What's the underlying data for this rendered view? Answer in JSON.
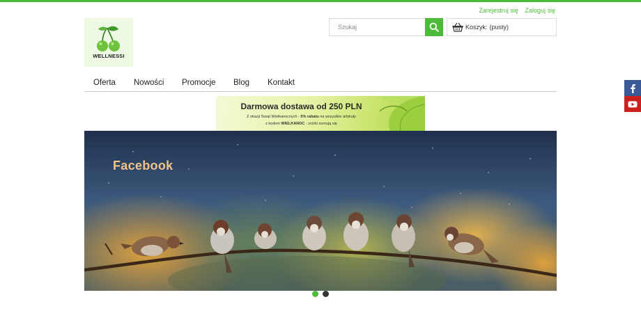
{
  "header": {
    "register_link": "Zarejestruj się",
    "login_link": "Zaloguj się",
    "logo_text": "WELLNESSI"
  },
  "search": {
    "placeholder": "Szukaj",
    "icon": "search-icon"
  },
  "cart": {
    "label": "Koszyk:",
    "status": "(pusty)",
    "icon": "basket-icon"
  },
  "nav": {
    "items": [
      "Oferta",
      "Nowości",
      "Promocje",
      "Blog",
      "Kontakt"
    ]
  },
  "promo_banner": {
    "title": "Darmowa dostawa od 250 PLN",
    "line1_a": "Z okazji Świąt Wielkanocnych - ",
    "line1_b": "5% rabatu",
    "line1_c": " na wszystkie artykuły",
    "line2_a": "z kodem ",
    "line2_b": "WIELKANOC",
    "line2_c": " - zniżki sumują się"
  },
  "slider": {
    "slide_title": "Facebook",
    "active_dot": 1
  },
  "social": {
    "icons": [
      "facebook-icon",
      "youtube-icon"
    ]
  },
  "colors": {
    "accent": "#4cbb3a",
    "facebook": "#3b5998",
    "youtube": "#cc1f20",
    "dot_inactive": "#333333"
  }
}
